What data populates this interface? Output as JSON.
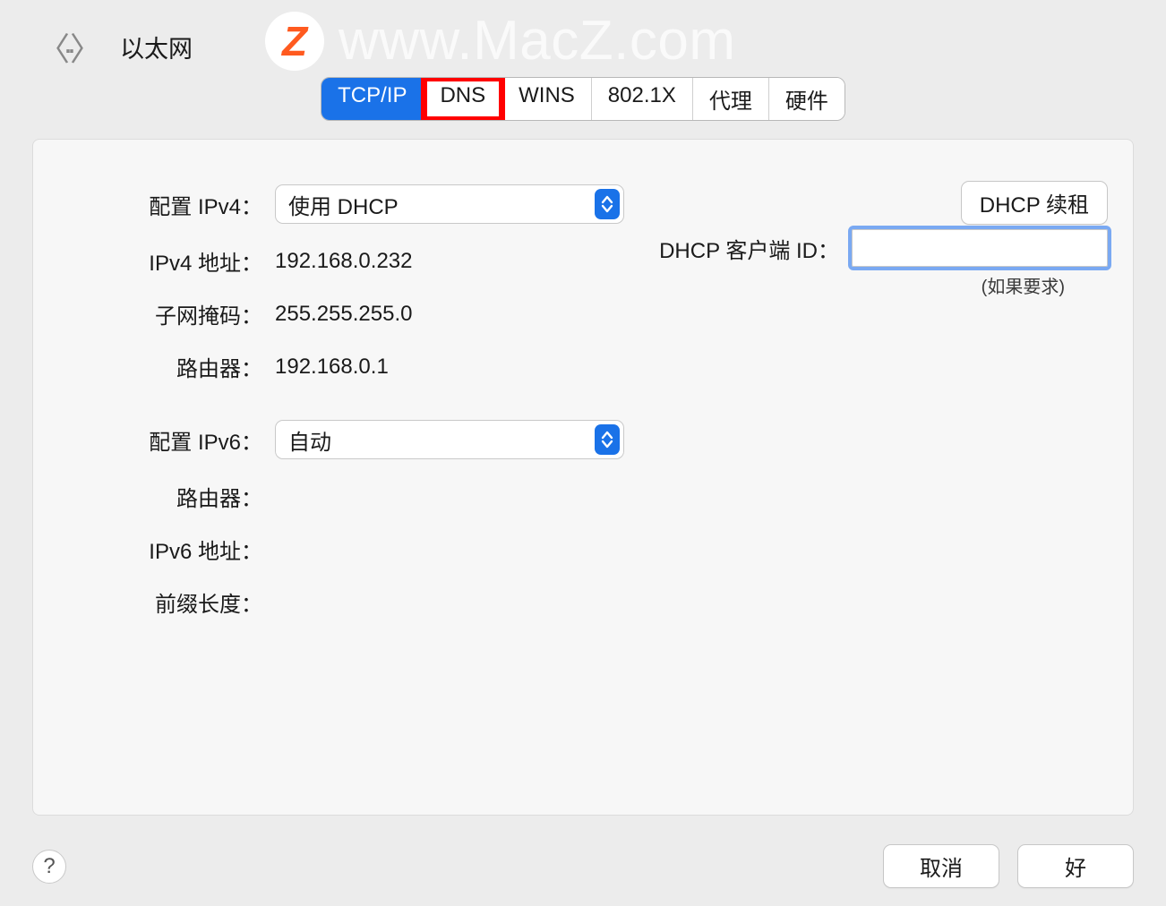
{
  "header": {
    "title": "以太网"
  },
  "watermark": {
    "logo_letter": "Z",
    "text": "www.MacZ.com"
  },
  "tabs": [
    {
      "label": "TCP/IP",
      "active": true
    },
    {
      "label": "DNS",
      "highlighted": true
    },
    {
      "label": "WINS"
    },
    {
      "label": "802.1X"
    },
    {
      "label": "代理"
    },
    {
      "label": "硬件"
    }
  ],
  "ipv4": {
    "configure_label": "配置 IPv4：",
    "configure_value": "使用 DHCP",
    "address_label": "IPv4 地址：",
    "address_value": "192.168.0.232",
    "subnet_label": "子网掩码：",
    "subnet_value": "255.255.255.0",
    "router_label": "路由器：",
    "router_value": "192.168.0.1"
  },
  "dhcp": {
    "renew_button": "DHCP 续租",
    "client_id_label": "DHCP 客户端 ID：",
    "client_id_value": "",
    "hint": "(如果要求)"
  },
  "ipv6": {
    "configure_label": "配置 IPv6：",
    "configure_value": "自动",
    "router_label": "路由器：",
    "router_value": "",
    "address_label": "IPv6 地址：",
    "address_value": "",
    "prefix_label": "前缀长度：",
    "prefix_value": ""
  },
  "footer": {
    "cancel": "取消",
    "ok": "好"
  }
}
